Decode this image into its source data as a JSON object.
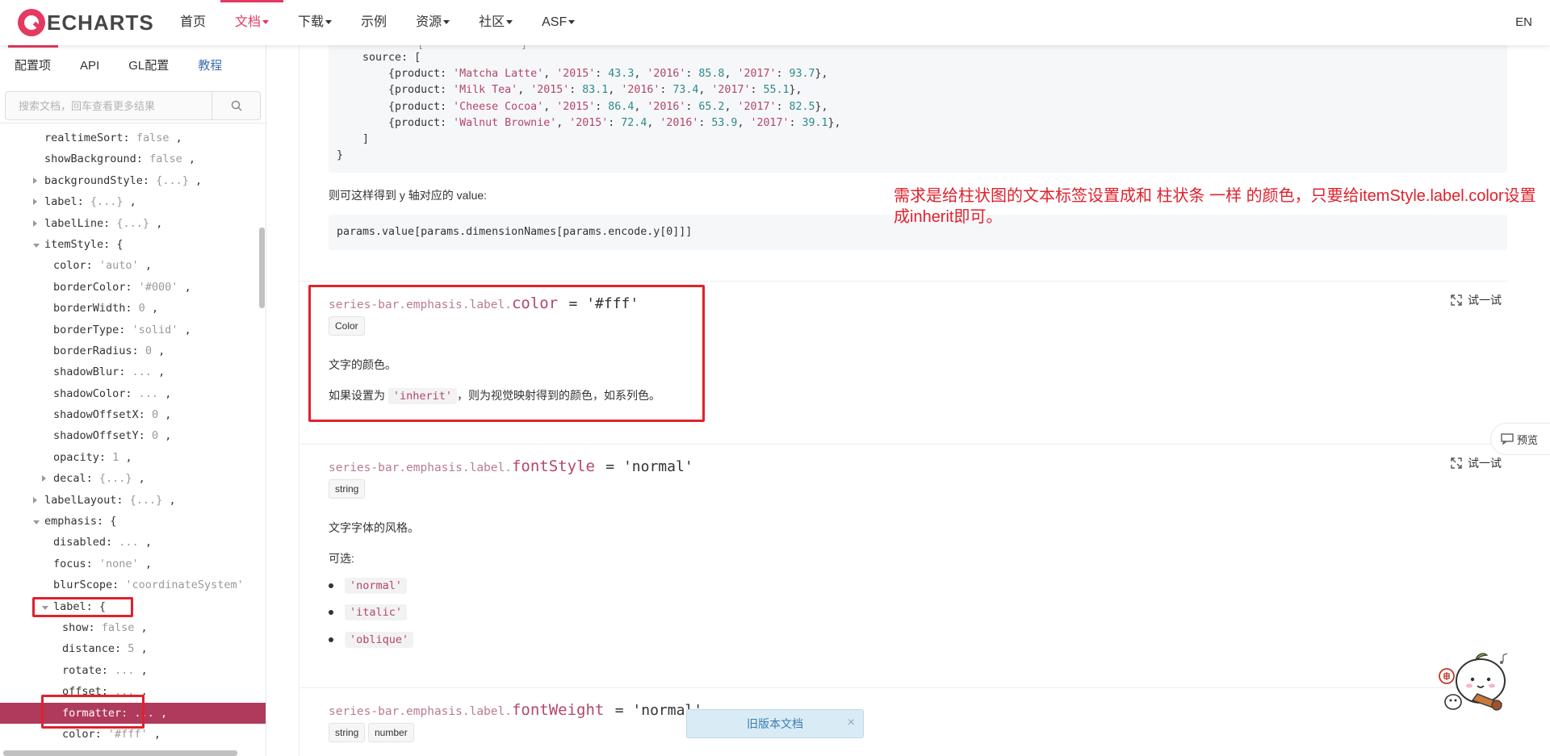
{
  "nav": {
    "logo_text": "ECHARTS",
    "items": [
      {
        "label": "首页",
        "caret": false,
        "active": false
      },
      {
        "label": "文档",
        "caret": true,
        "active": true
      },
      {
        "label": "下载",
        "caret": true,
        "active": false
      },
      {
        "label": "示例",
        "caret": false,
        "active": false
      },
      {
        "label": "资源",
        "caret": true,
        "active": false
      },
      {
        "label": "社区",
        "caret": true,
        "active": false
      },
      {
        "label": "ASF",
        "caret": true,
        "active": false
      }
    ],
    "lang": "EN"
  },
  "sidebar": {
    "tabs": [
      "配置项",
      "API",
      "GL配置",
      "教程"
    ],
    "search_placeholder": "搜索文档，回车查看更多结果",
    "tree": [
      {
        "key": "realtimeSort",
        "val": "false",
        "indent": 55,
        "arrow": "none"
      },
      {
        "key": "showBackground",
        "val": "false",
        "indent": 55,
        "arrow": "none"
      },
      {
        "key": "backgroundStyle",
        "val": "{...}",
        "indent": 55,
        "arrow": "right"
      },
      {
        "key": "label",
        "val": "{...}",
        "indent": 55,
        "arrow": "right"
      },
      {
        "key": "labelLine",
        "val": "{...}",
        "indent": 55,
        "arrow": "right"
      },
      {
        "key": "itemStyle",
        "val": "{",
        "indent": 55,
        "arrow": "down",
        "open": true
      },
      {
        "key": "color",
        "val": "'auto'",
        "indent": 66,
        "arrow": "none"
      },
      {
        "key": "borderColor",
        "val": "'#000'",
        "indent": 66,
        "arrow": "none"
      },
      {
        "key": "borderWidth",
        "val": "0",
        "indent": 66,
        "arrow": "none"
      },
      {
        "key": "borderType",
        "val": "'solid'",
        "indent": 66,
        "arrow": "none"
      },
      {
        "key": "borderRadius",
        "val": "0",
        "indent": 66,
        "arrow": "none"
      },
      {
        "key": "shadowBlur",
        "val": "...",
        "indent": 66,
        "arrow": "none"
      },
      {
        "key": "shadowColor",
        "val": "...",
        "indent": 66,
        "arrow": "none"
      },
      {
        "key": "shadowOffsetX",
        "val": "0",
        "indent": 66,
        "arrow": "none"
      },
      {
        "key": "shadowOffsetY",
        "val": "0",
        "indent": 66,
        "arrow": "none"
      },
      {
        "key": "opacity",
        "val": "1",
        "indent": 66,
        "arrow": "none"
      },
      {
        "key": "decal",
        "val": "{...}",
        "indent": 66,
        "arrow": "right"
      },
      {
        "key": "labelLayout",
        "val": "{...}",
        "indent": 55,
        "arrow": "right"
      },
      {
        "key": "emphasis",
        "val": "{",
        "indent": 55,
        "arrow": "down",
        "open": true
      },
      {
        "key": "disabled",
        "val": "...",
        "indent": 66,
        "arrow": "none"
      },
      {
        "key": "focus",
        "val": "'none'",
        "indent": 66,
        "arrow": "none"
      },
      {
        "key": "blurScope",
        "val": "'coordinateSystem'",
        "indent": 66,
        "arrow": "none",
        "nocomma": true
      },
      {
        "key": "label",
        "val": "{",
        "indent": 66,
        "arrow": "down",
        "open": true,
        "plain": true
      },
      {
        "key": "show",
        "val": "false",
        "indent": 77,
        "arrow": "none"
      },
      {
        "key": "distance",
        "val": "5",
        "indent": 77,
        "arrow": "none"
      },
      {
        "key": "rotate",
        "val": "...",
        "indent": 77,
        "arrow": "none"
      },
      {
        "key": "offset",
        "val": "...",
        "indent": 77,
        "arrow": "none"
      },
      {
        "key": "formatter",
        "val": "...",
        "indent": 77,
        "arrow": "none",
        "selected": true
      },
      {
        "key": "color",
        "val": "'#fff'",
        "indent": 77,
        "arrow": "none"
      }
    ]
  },
  "main": {
    "code_lines": [
      {
        "indent": 1,
        "html_key": "source_open"
      },
      {
        "indent": 2,
        "product": "Matcha Latte",
        "v2015": "43.3",
        "v2016": "85.8",
        "v2017": "93.7"
      },
      {
        "indent": 2,
        "product": "Milk Tea",
        "v2015": "83.1",
        "v2016": "73.4",
        "v2017": "55.1"
      },
      {
        "indent": 2,
        "product": "Cheese Cocoa",
        "v2015": "86.4",
        "v2016": "65.2",
        "v2017": "82.5"
      },
      {
        "indent": 2,
        "product": "Walnut Brownie",
        "v2015": "72.4",
        "v2016": "53.9",
        "v2017": "39.1"
      }
    ],
    "code_source_label": "source: [",
    "code_close_bracket": "]",
    "code_close_brace": "}",
    "value_intro": "则可这样得到 y 轴对应的 value:",
    "value_code": "params.value[params.dimensionNames[params.encode.y[0]]]",
    "sections": [
      {
        "path": "series-bar.emphasis.label.",
        "name": "color",
        "default": "= '#fff'",
        "types": [
          "Color"
        ],
        "desc1": "文字的颜色。",
        "desc2_pre": "如果设置为",
        "desc2_code": "'inherit'",
        "desc2_post": "，则为视觉映射得到的颜色，如系列色。"
      },
      {
        "path": "series-bar.emphasis.label.",
        "name": "fontStyle",
        "default": "= 'normal'",
        "types": [
          "string"
        ],
        "desc1": "文字字体的风格。",
        "options_label": "可选:",
        "options": [
          "'normal'",
          "'italic'",
          "'oblique'"
        ]
      },
      {
        "path": "series-bar.emphasis.label.",
        "name": "fontWeight",
        "default": "= 'normal'",
        "types": [
          "string",
          "number"
        ]
      }
    ],
    "try_label": "试一试",
    "annotation": "需求是给柱状图的文本标签设置成和 柱状条 一样 的颜色，只要给itemStyle.label.color设置成inherit即可。",
    "preview_label": "预览",
    "old_doc_label": "旧版本文档",
    "old_doc_close": "×"
  },
  "colors": {
    "accent": "#e43961",
    "highlight_box": "#e0212d",
    "selected_row": "#b03a5b",
    "string_literal": "#b44767",
    "number_literal": "#2d8a8a",
    "tutorial_link": "#3e6cb4"
  }
}
